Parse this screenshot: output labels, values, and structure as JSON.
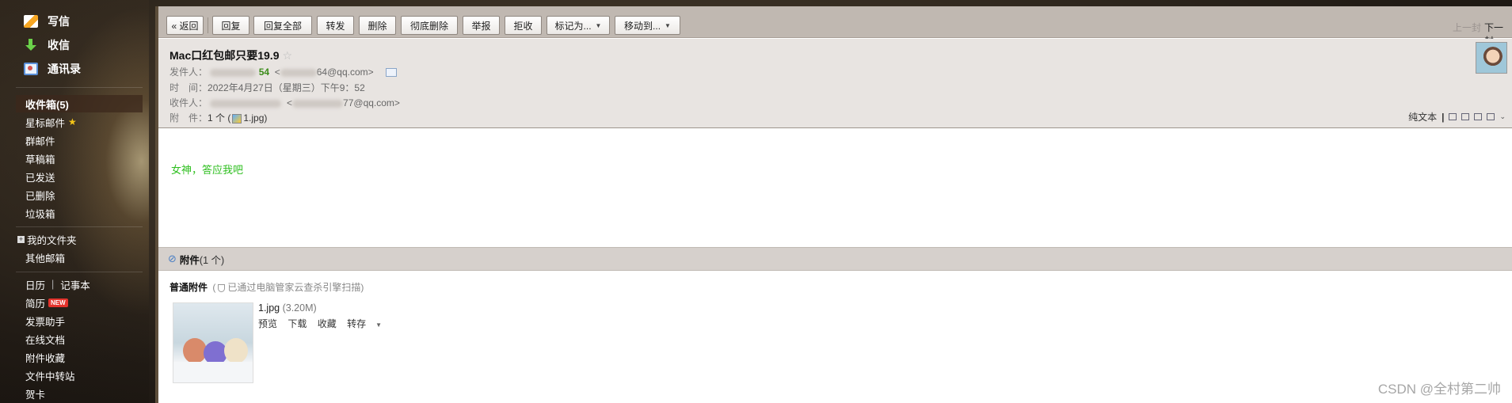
{
  "sidebar": {
    "write": "写信",
    "receive": "收信",
    "contacts": "通讯录",
    "inbox": "收件箱(5)",
    "items": [
      "星标邮件",
      "群邮件",
      "草稿箱",
      "已发送",
      "已删除",
      "垃圾箱"
    ],
    "my_folders": "我的文件夹",
    "other_mailbox": "其他邮箱",
    "calendar": "日历",
    "notes": "记事本",
    "resume": "简历",
    "new_badge": "NEW",
    "tools": [
      "发票助手",
      "在线文档",
      "附件收藏",
      "文件中转站",
      "贺卡"
    ]
  },
  "toolbar": {
    "back": "« 返回",
    "reply": "回复",
    "reply_all": "回复全部",
    "forward": "转发",
    "delete": "删除",
    "delete_perm": "彻底删除",
    "report": "举报",
    "reject": "拒收",
    "mark_as": "标记为...",
    "move_to": "移动到...",
    "prev": "上一封",
    "next": "下一封"
  },
  "mail": {
    "subject": "Mac口红包邮只要19.9",
    "from_label": "发件人：",
    "from_name_suffix": "54",
    "from_addr_suffix": "64@qq.com>",
    "time_label": "时　间：",
    "time_value": "2022年4月27日（星期三）下午9：52",
    "to_label": "收件人：",
    "to_addr_suffix": "77@qq.com>",
    "att_label": "附　件：",
    "att_value_prefix": "1 个 (",
    "att_value_file": "1.jpg",
    "att_value_suffix": ")",
    "plain_text": "纯文本",
    "body": "女神，答应我吧"
  },
  "attachments": {
    "title": "附件",
    "count": "(1 个)",
    "normal_label": "普通附件",
    "scan_prefix": "(",
    "scan_note": "已通过电脑管家云查杀引擎扫描)",
    "file_name": "1.jpg",
    "file_size": "(3.20M)",
    "actions": [
      "预览",
      "下载",
      "收藏",
      "转存"
    ]
  },
  "watermark": "CSDN @全村第二帅",
  "colors": {
    "body_text": "#2ebf1f",
    "sender_name": "#3c8c1a",
    "new_badge": "#e3332c"
  }
}
